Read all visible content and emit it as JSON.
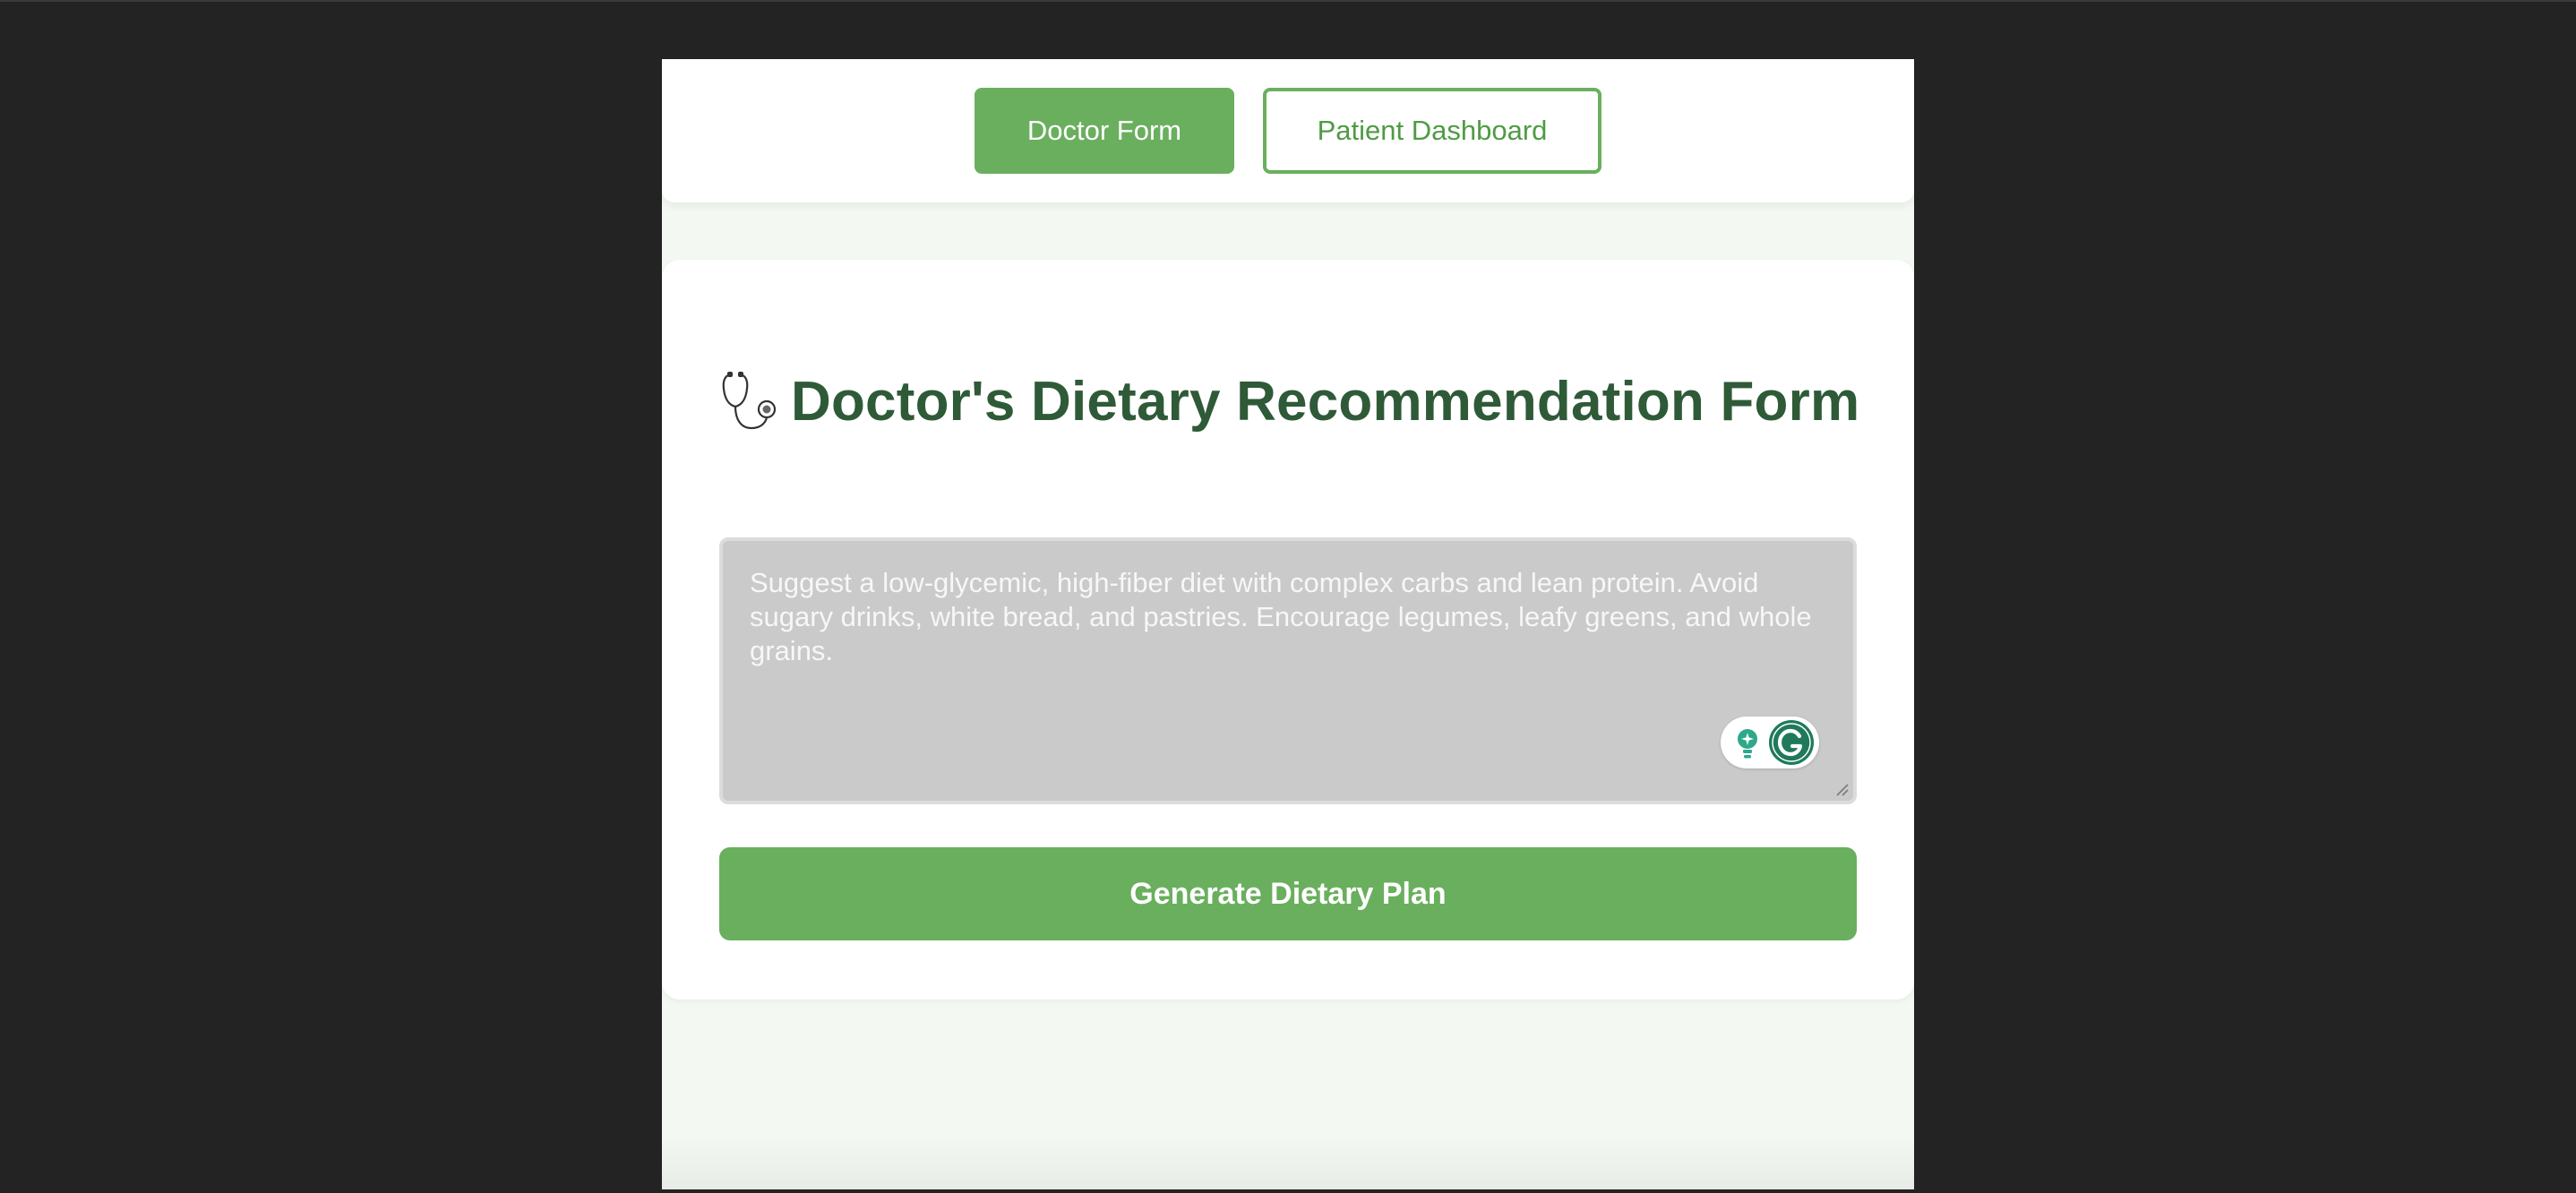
{
  "nav": {
    "doctor_form_label": "Doctor Form",
    "patient_dashboard_label": "Patient Dashboard",
    "active_tab": "Doctor Form"
  },
  "form": {
    "title": "Doctor's Dietary Recommendation Form",
    "title_icon": "stethoscope-icon",
    "recommendation_text": "Suggest a low-glycemic, high-fiber diet with complex carbs and lean protein. Avoid sugary drinks, white bread, and pastries. Encourage legumes, leafy greens, and whole grains.",
    "submit_label": "Generate Dietary Plan"
  },
  "extensions": {
    "icons": [
      "lightbulb-icon",
      "grammarly-icon"
    ]
  },
  "colors": {
    "accent": "#6aaf5e",
    "title": "#2f5a38",
    "page_background": "#f4f8f3",
    "textarea_background": "#cacaca"
  }
}
